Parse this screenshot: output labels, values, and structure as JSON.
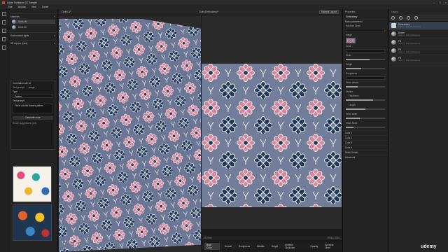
{
  "app": {
    "title": "Adobe Substance 3D Sampler"
  },
  "menu": [
    "Edit",
    "Window",
    "View",
    "Create"
  ],
  "left_panel": {
    "section_materials": "Materials",
    "materials": [
      "Cloth UV",
      "Cloth 02"
    ],
    "section_env": "Environment lights",
    "section_3d": "3D objects (beta)",
    "card": {
      "title": "Generation with AI",
      "tabs": [
        "Text prompt",
        "Image"
      ],
      "type_label": "Type",
      "type_value": "Pattern",
      "prompt_label": "Text prompt",
      "prompt_value": "Floral colorful flowers pattern",
      "button": "Generate more",
      "results_label": "Result suggestions (2/4)"
    }
  },
  "viewport": {
    "tab": "Cloth UV",
    "title": "Cloth (Embroidery)*",
    "dropdown": "Material Layout",
    "status_left": "2D View",
    "status_right": "2048 x 2048"
  },
  "channels": [
    "Base Color",
    "Normal",
    "Roughness",
    "Metallic",
    "Height",
    "Ambient Occlusion",
    "Opacity",
    "Specular Level"
  ],
  "properties": {
    "tab": "Properties",
    "header": "Embroidery",
    "section": "Basic parameters",
    "rows": [
      "Random Seed",
      "Image",
      "Color",
      "Scale",
      "Height",
      "Roughness",
      "Stitch details",
      "Outline",
      "Thickness",
      "Length",
      "Stitch width",
      "Stitch Seed"
    ],
    "groups": [
      "Color 1",
      "Color 2",
      "Color 3",
      "Color 4",
      "Stitch Details",
      "Advanced"
    ]
  },
  "layers": {
    "tab": "Layers",
    "items": [
      {
        "name": "Embroidery",
        "sub": "Layer 1 · Multi (Embroidery)"
      },
      {
        "name": "Denim",
        "sub": "Layer 1 · Multi (Substance)"
      },
      {
        "name": "Fill",
        "sub": "Layer 1 · Multi (Substance)"
      },
      {
        "name": "Fill",
        "sub": "Layer 1 · Multi (Substance)"
      },
      {
        "name": "Fill",
        "sub": "Layer 1 · Multi (Substance)"
      }
    ]
  },
  "watermark": "udemy",
  "colors": {
    "denim": "#6b7695",
    "pink": "#d9869d",
    "navy": "#223a59",
    "white": "#f2f2f2"
  }
}
